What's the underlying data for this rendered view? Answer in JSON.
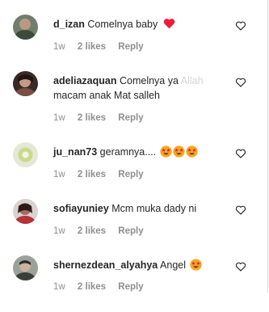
{
  "comments": [
    {
      "username": "d_izan",
      "text": "Comelnya baby",
      "time": "1w",
      "likes": "2 likes",
      "reply": "Reply"
    },
    {
      "username": "adeliazaquan",
      "text": "Comelnya ya",
      "text_fade": "Allah",
      "text_line2": "macam anak Mat salleh",
      "time": "1w",
      "likes": "2 likes",
      "reply": "Reply"
    },
    {
      "username": "ju_nan73",
      "text": "geramnya....",
      "time": "1w",
      "likes": "2 likes",
      "reply": "Reply"
    },
    {
      "username": "sofiayuniey",
      "text": "Mcm muka dady ni",
      "time": "1w",
      "likes": "2 likes",
      "reply": "Reply"
    },
    {
      "username": "shernezdean_alyahya",
      "text": "Angel",
      "time": "1w",
      "likes": "2 likes",
      "reply": "Reply"
    }
  ],
  "icons": {
    "like": "heart-outline-icon",
    "red_heart": "red-heart-emoji",
    "star_eyes": "star-struck-emoji"
  },
  "colors": {
    "text": "#262626",
    "meta": "#8e8e8e",
    "red_heart": "#ed1c3a",
    "emoji": "#f5a623"
  }
}
